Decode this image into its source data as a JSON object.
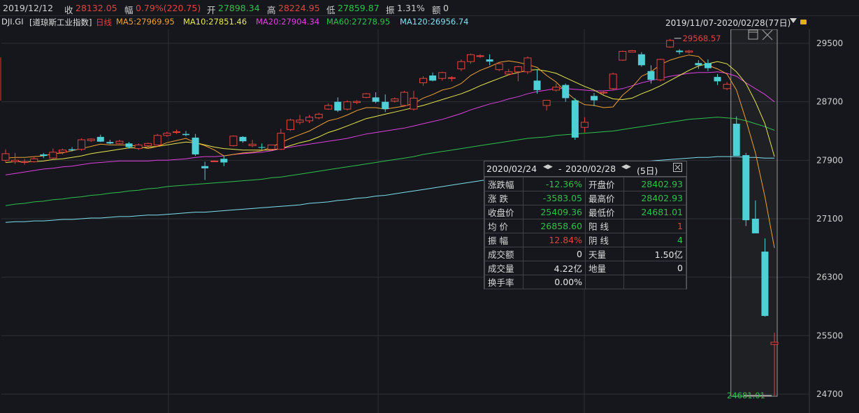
{
  "topbar": {
    "date": "2019/12/12",
    "close_label": "收",
    "close_value": "28132.05",
    "change_label": "幅",
    "change_value": "0.79%(220.75)",
    "open_label": "开",
    "open_value": "27898.34",
    "high_label": "高",
    "high_value": "28224.95",
    "low_label": "低",
    "low_value": "27859.87",
    "amp_label": "振",
    "amp_value": "1.31%",
    "amount_label": "额",
    "amount_value": "0"
  },
  "legend": {
    "symbol": "DJI.GI",
    "name": "[道琼斯工业指数]",
    "period": "日线",
    "ma5": "MA5:27969.95",
    "ma10": "MA10:27851.46",
    "ma20": "MA20:27904.34",
    "ma60": "MA60:27278.95",
    "ma120": "MA120:26956.74",
    "range": "2019/11/07-2020/02/28(77日)"
  },
  "colors": {
    "up": "#e8413c",
    "down": "#4dd0d6",
    "ma5": "#f0a030",
    "ma10": "#e8e84a",
    "ma20": "#e040e0",
    "ma60": "#2ec24a",
    "ma120": "#7fe0f0",
    "grid": "#2c2f35"
  },
  "chart_data": {
    "type": "candlestick",
    "title": "DJI.GI",
    "ylim": [
      24500,
      29700
    ],
    "yticks": [
      "29500",
      "28700",
      "27900",
      "27100",
      "26300",
      "25500",
      "24700"
    ],
    "high_marker": "29568.57",
    "low_marker": "24681.01",
    "candles": [
      [
        27900,
        28050,
        27870,
        27990
      ],
      [
        27880,
        28000,
        27850,
        27900
      ],
      [
        27880,
        27920,
        27840,
        27880
      ],
      [
        27880,
        27940,
        27870,
        27920
      ],
      [
        27980,
        28000,
        27930,
        27960
      ],
      [
        27930,
        28060,
        27920,
        28010
      ],
      [
        28010,
        28060,
        27980,
        28040
      ],
      [
        28050,
        28080,
        28020,
        28035
      ],
      [
        28050,
        28200,
        28030,
        28180
      ],
      [
        28170,
        28200,
        28150,
        28190
      ],
      [
        28220,
        28250,
        28150,
        28155
      ],
      [
        28150,
        28180,
        28120,
        28130
      ],
      [
        28130,
        28180,
        28120,
        28160
      ],
      [
        28130,
        28150,
        28060,
        28080
      ],
      [
        28060,
        28130,
        28040,
        28110
      ],
      [
        28100,
        28140,
        28080,
        28130
      ],
      [
        28110,
        28260,
        28100,
        28240
      ],
      [
        28240,
        28290,
        28220,
        28270
      ],
      [
        28290,
        28320,
        28260,
        28290
      ],
      [
        28260,
        28300,
        28230,
        28245
      ],
      [
        28210,
        28260,
        27960,
        27980
      ],
      [
        27820,
        27880,
        27630,
        27790
      ],
      [
        27880,
        27900,
        27880,
        27890
      ],
      [
        27920,
        27960,
        27820,
        27870
      ],
      [
        28100,
        28240,
        28090,
        28230
      ],
      [
        28220,
        28230,
        28140,
        28160
      ],
      [
        28100,
        28180,
        28080,
        28120
      ],
      [
        28080,
        28130,
        28050,
        28070
      ],
      [
        28050,
        28110,
        28030,
        28110
      ],
      [
        28050,
        28330,
        28040,
        28270
      ],
      [
        28320,
        28470,
        28300,
        28450
      ],
      [
        28420,
        28520,
        28390,
        28450
      ],
      [
        28440,
        28520,
        28410,
        28490
      ],
      [
        28480,
        28550,
        28460,
        28530
      ],
      [
        28600,
        28680,
        28590,
        28650
      ],
      [
        28700,
        28760,
        28560,
        28580
      ],
      [
        28600,
        28720,
        28580,
        28700
      ],
      [
        28690,
        28720,
        28670,
        28705
      ],
      [
        28760,
        28820,
        28750,
        28810
      ],
      [
        28760,
        28830,
        28680,
        28700
      ],
      [
        28700,
        28800,
        28560,
        28600
      ],
      [
        28710,
        28760,
        28690,
        28740
      ],
      [
        28650,
        28850,
        28640,
        28830
      ],
      [
        28600,
        28850,
        28580,
        28750
      ],
      [
        28960,
        29050,
        28920,
        29020
      ],
      [
        29060,
        29100,
        28980,
        28990
      ],
      [
        29020,
        29110,
        28990,
        29100
      ],
      [
        29020,
        29050,
        28980,
        29030
      ],
      [
        29150,
        29280,
        29120,
        29250
      ],
      [
        29250,
        29360,
        29220,
        29345
      ],
      [
        29320,
        29350,
        29300,
        29330
      ],
      [
        29280,
        29350,
        29200,
        29250
      ],
      [
        29140,
        29230,
        29120,
        29220
      ],
      [
        29080,
        29150,
        29060,
        29110
      ],
      [
        29110,
        29190,
        28980,
        29180
      ],
      [
        29110,
        29320,
        29080,
        29300
      ],
      [
        28990,
        29140,
        28810,
        28860
      ],
      [
        28650,
        28720,
        28580,
        28720
      ],
      [
        28860,
        28950,
        28840,
        28900
      ],
      [
        28930,
        28950,
        28700,
        28750
      ],
      [
        28720,
        28750,
        28180,
        28210
      ],
      [
        28350,
        28490,
        28280,
        28420
      ],
      [
        28780,
        28820,
        28640,
        28720
      ],
      [
        28820,
        28850,
        28800,
        28830
      ],
      [
        28880,
        29100,
        28860,
        29080
      ],
      [
        29270,
        29400,
        29260,
        29390
      ],
      [
        29380,
        29410,
        29380,
        29400
      ],
      [
        29350,
        29380,
        29180,
        29200
      ],
      [
        29120,
        29200,
        28950,
        29000
      ],
      [
        29000,
        29290,
        28980,
        29280
      ],
      [
        29450,
        29560,
        29440,
        29540
      ],
      [
        29400,
        29420,
        29350,
        29380
      ],
      [
        29380,
        29410,
        29360,
        29395
      ],
      [
        29230,
        29270,
        29150,
        29200
      ],
      [
        29230,
        29280,
        29120,
        29160
      ],
      [
        29040,
        29080,
        28930,
        28980
      ],
      [
        28880,
        28970,
        28860,
        28940
      ],
      [
        28400,
        28500,
        28380,
        27960
      ],
      [
        27970,
        28000,
        27000,
        27080
      ],
      [
        27100,
        27350,
        26980,
        26900
      ],
      [
        26650,
        26830,
        25760,
        25770
      ],
      [
        25380,
        25540,
        24681,
        25410
      ]
    ],
    "ma5": [
      27930,
      27940,
      27940,
      27950,
      27960,
      27990,
      28000,
      28030,
      28060,
      28090,
      28120,
      28110,
      28110,
      28110,
      28090,
      28060,
      28090,
      28140,
      28170,
      28200,
      28140,
      28100,
      28040,
      27960,
      27980,
      28000,
      28010,
      28030,
      28080,
      28140,
      28200,
      28250,
      28300,
      28370,
      28440,
      28470,
      28520,
      28580,
      28620,
      28620,
      28600,
      28620,
      28640,
      28680,
      28750,
      28800,
      28860,
      28890,
      28950,
      29060,
      29130,
      29180,
      29240,
      29260,
      29240,
      29210,
      29170,
      29060,
      28970,
      28840,
      28730,
      28660,
      28650,
      28620,
      28630,
      28790,
      28900,
      29050,
      29110,
      29210,
      29270,
      29310,
      29340,
      29320,
      29200,
      29150,
      29080,
      28860,
      28450,
      28000,
      27400,
      26700
    ],
    "ma10": [
      27870,
      27880,
      27880,
      27880,
      27890,
      27910,
      27920,
      27940,
      27960,
      27990,
      28010,
      28030,
      28050,
      28070,
      28070,
      28080,
      28090,
      28110,
      28130,
      28150,
      28140,
      28110,
      28080,
      28060,
      28050,
      28040,
      28040,
      28040,
      28040,
      28060,
      28100,
      28140,
      28170,
      28220,
      28280,
      28320,
      28370,
      28420,
      28470,
      28500,
      28530,
      28560,
      28590,
      28620,
      28650,
      28690,
      28730,
      28770,
      28810,
      28860,
      28920,
      28970,
      29020,
      29070,
      29100,
      29130,
      29140,
      29120,
      29090,
      29030,
      28970,
      28910,
      28860,
      28790,
      28740,
      28730,
      28750,
      28810,
      28860,
      28920,
      28990,
      29060,
      29130,
      29190,
      29220,
      29250,
      29220,
      29110,
      28950,
      28700,
      28400,
      27950
    ],
    "ma20": [
      27700,
      27720,
      27740,
      27760,
      27780,
      27790,
      27810,
      27820,
      27840,
      27860,
      27870,
      27880,
      27890,
      27890,
      27890,
      27890,
      27900,
      27900,
      27910,
      27920,
      27940,
      27950,
      27950,
      27960,
      27980,
      27990,
      28000,
      28010,
      28030,
      28060,
      28080,
      28100,
      28120,
      28140,
      28160,
      28180,
      28200,
      28230,
      28260,
      28280,
      28300,
      28320,
      28340,
      28370,
      28400,
      28430,
      28460,
      28500,
      28540,
      28590,
      28630,
      28670,
      28700,
      28740,
      28770,
      28810,
      28840,
      28860,
      28880,
      28880,
      28870,
      28860,
      28850,
      28850,
      28860,
      28880,
      28920,
      28960,
      28990,
      29020,
      29050,
      29070,
      29090,
      29100,
      29100,
      29110,
      29090,
      29050,
      28960,
      28880,
      28800,
      28700
    ],
    "ma60": [
      27280,
      27300,
      27310,
      27330,
      27340,
      27360,
      27370,
      27390,
      27400,
      27420,
      27430,
      27450,
      27460,
      27480,
      27490,
      27510,
      27520,
      27540,
      27550,
      27560,
      27570,
      27580,
      27590,
      27600,
      27610,
      27620,
      27630,
      27640,
      27660,
      27670,
      27690,
      27710,
      27730,
      27750,
      27770,
      27790,
      27810,
      27830,
      27850,
      27870,
      27890,
      27910,
      27930,
      27950,
      27980,
      28000,
      28020,
      28040,
      28060,
      28080,
      28100,
      28120,
      28140,
      28160,
      28180,
      28200,
      28210,
      28220,
      28240,
      28250,
      28260,
      28270,
      28280,
      28290,
      28300,
      28320,
      28340,
      28360,
      28380,
      28400,
      28420,
      28440,
      28460,
      28470,
      28480,
      28490,
      28480,
      28470,
      28440,
      28400,
      28360,
      28310
    ],
    "ma120": [
      27050,
      27060,
      27060,
      27070,
      27070,
      27080,
      27090,
      27090,
      27100,
      27110,
      27110,
      27120,
      27130,
      27130,
      27140,
      27150,
      27150,
      27160,
      27170,
      27180,
      27190,
      27190,
      27200,
      27210,
      27220,
      27230,
      27240,
      27250,
      27260,
      27270,
      27280,
      27290,
      27310,
      27320,
      27330,
      27350,
      27360,
      27380,
      27390,
      27410,
      27420,
      27440,
      27460,
      27480,
      27500,
      27520,
      27540,
      27560,
      27580,
      27600,
      27620,
      27640,
      27660,
      27680,
      27700,
      27720,
      27740,
      27760,
      27780,
      27790,
      27810,
      27820,
      27830,
      27840,
      27850,
      27860,
      27870,
      27880,
      27890,
      27900,
      27910,
      27920,
      27930,
      27940,
      27940,
      27950,
      27950,
      27950,
      27940,
      27940,
      27930,
      27930
    ]
  },
  "infobox": {
    "title_start": "2020/02/24",
    "title_sep": "-",
    "title_end": "2020/02/28",
    "title_days": "(5日)",
    "rows": [
      {
        "k1": "涨跌幅",
        "v1": "-12.36%",
        "c1": "green",
        "k2": "开盘价",
        "v2": "28402.93",
        "c2": "green"
      },
      {
        "k1": "涨  跌",
        "v1": "-3583.05",
        "c1": "green",
        "k2": "最高价",
        "v2": "28402.93",
        "c2": "green"
      },
      {
        "k1": "收盘价",
        "v1": "25409.36",
        "c1": "green",
        "k2": "最低价",
        "v2": "24681.01",
        "c2": "green"
      },
      {
        "k1": "均  价",
        "v1": "26858.60",
        "c1": "green",
        "k2": "阳  线",
        "v2": "1",
        "c2": "red"
      },
      {
        "k1": "振  幅",
        "v1": "12.84%",
        "c1": "red",
        "k2": "阴  线",
        "v2": "4",
        "c2": "green"
      },
      {
        "k1": "成交额",
        "v1": "0",
        "c1": "white",
        "k2": "天量",
        "v2": "1.50亿",
        "c2": "white"
      },
      {
        "k1": "成交量",
        "v1": "4.22亿",
        "c1": "white",
        "k2": "地量",
        "v2": "0",
        "c2": "white"
      },
      {
        "k1": "换手率",
        "v1": "0.00%",
        "c1": "white",
        "k2": "",
        "v2": "",
        "c2": "white"
      }
    ]
  }
}
